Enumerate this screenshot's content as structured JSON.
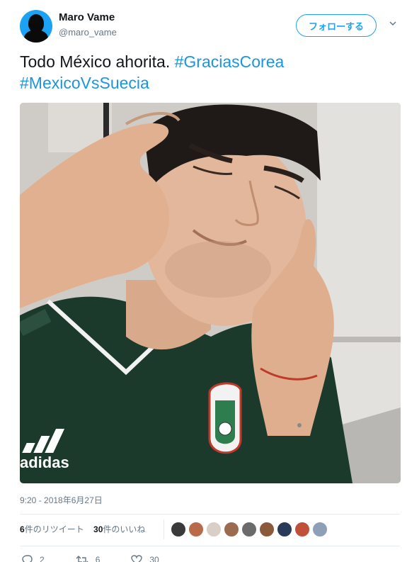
{
  "user": {
    "name": "Maro Vame",
    "handle": "@maro_vame"
  },
  "follow_button": {
    "label": "フォローする"
  },
  "tweet": {
    "text_plain": "Todo México ahorita. ",
    "hashtag_1": "#GraciasCorea",
    "hashtag_2": "#MexicoVsSuecia"
  },
  "photo": {
    "brand_text": "adidas"
  },
  "timestamp": "9:20 - 2018年6月27日",
  "stats": {
    "retweets_count": "6",
    "retweets_label": "件のリツイート",
    "likes_count": "30",
    "likes_label": "件のいいね"
  },
  "likers": [
    "#3a3a3a",
    "#b86b4b",
    "#d9cfc7",
    "#9c6a4f",
    "#6b6b6b",
    "#8a5a3a",
    "#2a3a5a",
    "#c0503a",
    "#8da0b8"
  ],
  "actions": {
    "reply_count": "2",
    "retweet_count": "6",
    "like_count": "30"
  },
  "colors": {
    "accent": "#1da1f2",
    "link": "#1b95e0",
    "jersey": "#1c3a2c"
  }
}
